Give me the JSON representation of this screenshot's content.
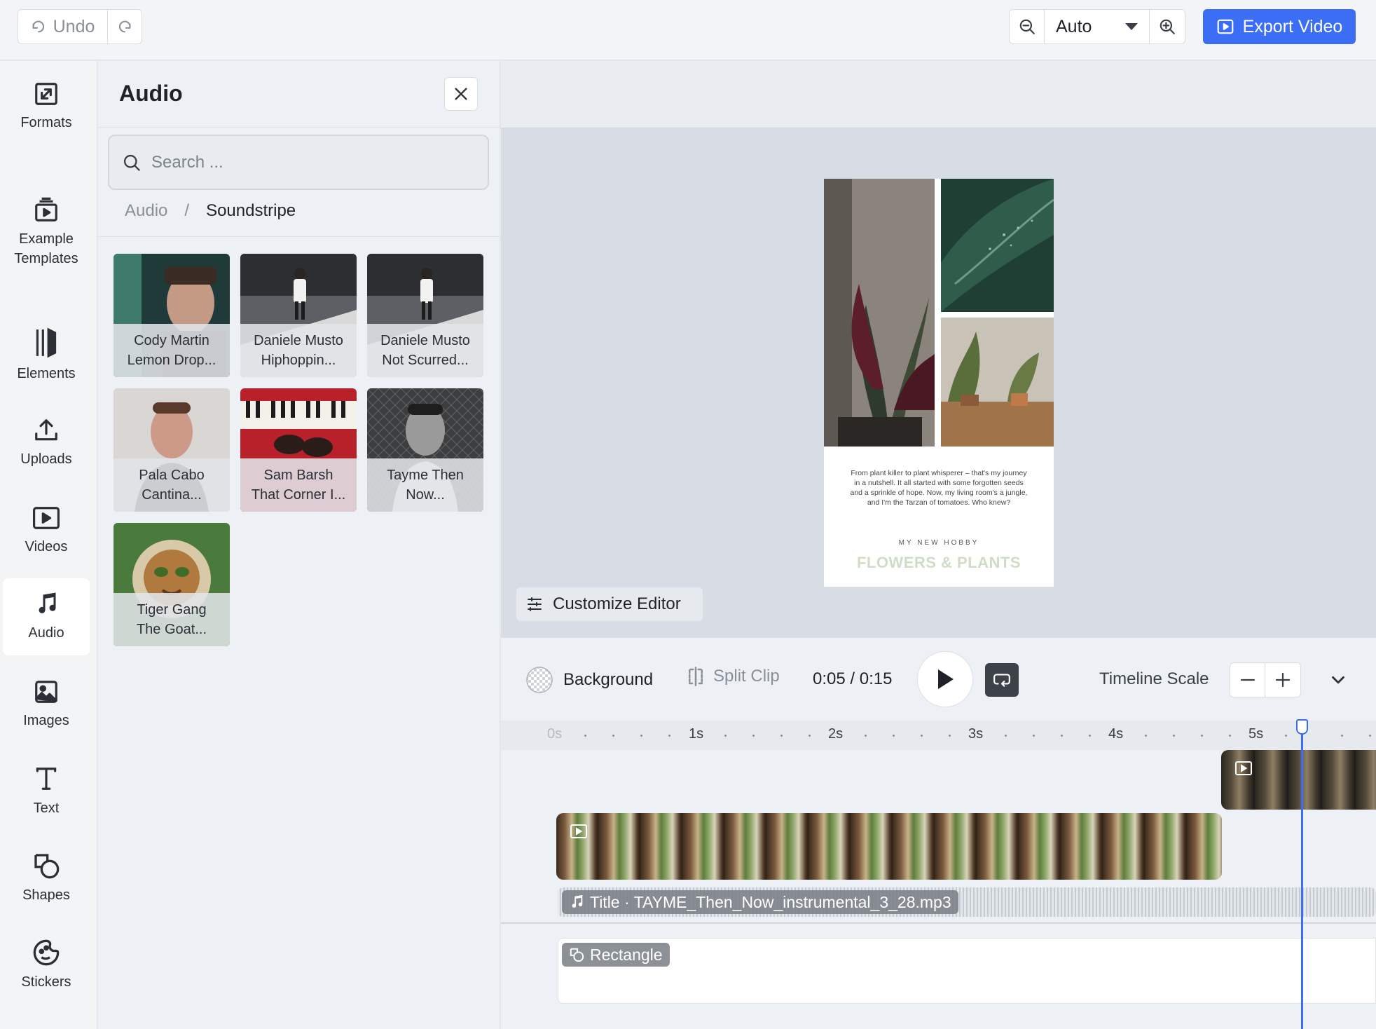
{
  "toolbar": {
    "undo_label": "Undo",
    "zoom_value": "Auto",
    "export_label": "Export Video"
  },
  "nav": [
    {
      "id": "formats",
      "label": "Formats",
      "icon": "resize-icon"
    },
    {
      "id": "templates",
      "label": "Example\nTemplates",
      "icon": "template-icon"
    },
    {
      "id": "elements",
      "label": "Elements",
      "icon": "elements-icon"
    },
    {
      "id": "uploads",
      "label": "Uploads",
      "icon": "upload-icon"
    },
    {
      "id": "videos",
      "label": "Videos",
      "icon": "video-icon"
    },
    {
      "id": "audio",
      "label": "Audio",
      "icon": "music-note-icon",
      "active": true
    },
    {
      "id": "images",
      "label": "Images",
      "icon": "image-icon"
    },
    {
      "id": "text",
      "label": "Text",
      "icon": "text-icon"
    },
    {
      "id": "shapes",
      "label": "Shapes",
      "icon": "shapes-icon"
    },
    {
      "id": "stickers",
      "label": "Stickers",
      "icon": "sticker-icon"
    }
  ],
  "panel": {
    "title": "Audio",
    "search_placeholder": "Search ...",
    "breadcrumb_root": "Audio",
    "breadcrumb_sep": "/",
    "breadcrumb_current": "Soundstripe",
    "tracks": [
      {
        "line1": "Cody Martin",
        "line2": "Lemon Drop..."
      },
      {
        "line1": "Daniele Musto",
        "line2": "Hiphoppin..."
      },
      {
        "line1": "Daniele Musto",
        "line2": "Not Scurred..."
      },
      {
        "line1": "Pala Cabo",
        "line2": "Cantina..."
      },
      {
        "line1": "Sam Barsh",
        "line2": "That Corner I..."
      },
      {
        "line1": "Tayme Then",
        "line2": "Now..."
      },
      {
        "line1": "Tiger Gang",
        "line2": "The Goat..."
      }
    ]
  },
  "artboard": {
    "body": "From plant killer to plant whisperer – that's my journey in a nutshell. It all started with some forgotten seeds and a sprinkle of hope. Now, my living room's a jungle, and I'm the Tarzan of tomatoes. Who knew?",
    "kicker": "MY NEW HOBBY",
    "headline": "FLOWERS & PLANTS"
  },
  "editor": {
    "customize_label": "Customize Editor",
    "background_label": "Background",
    "split_label": "Split Clip",
    "timecode": "0:05 / 0:15",
    "scale_label": "Timeline Scale"
  },
  "timeline": {
    "ticks": [
      "0s",
      "1s",
      "2s",
      "3s",
      "4s",
      "5s"
    ],
    "audio_clip_label": "Title · TAYME_Then_Now_instrumental_3_28.mp3",
    "shape_clip_label": "Rectangle"
  },
  "colors": {
    "accent": "#3b6ef5",
    "headline": "#cfdcc6"
  }
}
